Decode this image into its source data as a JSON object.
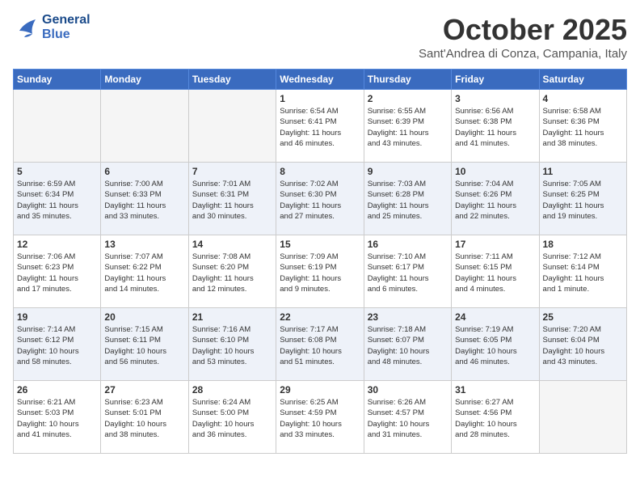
{
  "header": {
    "logo_line1": "General",
    "logo_line2": "Blue",
    "month": "October 2025",
    "location": "Sant'Andrea di Conza, Campania, Italy"
  },
  "days_of_week": [
    "Sunday",
    "Monday",
    "Tuesday",
    "Wednesday",
    "Thursday",
    "Friday",
    "Saturday"
  ],
  "weeks": [
    [
      {
        "day": "",
        "info": ""
      },
      {
        "day": "",
        "info": ""
      },
      {
        "day": "",
        "info": ""
      },
      {
        "day": "1",
        "info": "Sunrise: 6:54 AM\nSunset: 6:41 PM\nDaylight: 11 hours\nand 46 minutes."
      },
      {
        "day": "2",
        "info": "Sunrise: 6:55 AM\nSunset: 6:39 PM\nDaylight: 11 hours\nand 43 minutes."
      },
      {
        "day": "3",
        "info": "Sunrise: 6:56 AM\nSunset: 6:38 PM\nDaylight: 11 hours\nand 41 minutes."
      },
      {
        "day": "4",
        "info": "Sunrise: 6:58 AM\nSunset: 6:36 PM\nDaylight: 11 hours\nand 38 minutes."
      }
    ],
    [
      {
        "day": "5",
        "info": "Sunrise: 6:59 AM\nSunset: 6:34 PM\nDaylight: 11 hours\nand 35 minutes."
      },
      {
        "day": "6",
        "info": "Sunrise: 7:00 AM\nSunset: 6:33 PM\nDaylight: 11 hours\nand 33 minutes."
      },
      {
        "day": "7",
        "info": "Sunrise: 7:01 AM\nSunset: 6:31 PM\nDaylight: 11 hours\nand 30 minutes."
      },
      {
        "day": "8",
        "info": "Sunrise: 7:02 AM\nSunset: 6:30 PM\nDaylight: 11 hours\nand 27 minutes."
      },
      {
        "day": "9",
        "info": "Sunrise: 7:03 AM\nSunset: 6:28 PM\nDaylight: 11 hours\nand 25 minutes."
      },
      {
        "day": "10",
        "info": "Sunrise: 7:04 AM\nSunset: 6:26 PM\nDaylight: 11 hours\nand 22 minutes."
      },
      {
        "day": "11",
        "info": "Sunrise: 7:05 AM\nSunset: 6:25 PM\nDaylight: 11 hours\nand 19 minutes."
      }
    ],
    [
      {
        "day": "12",
        "info": "Sunrise: 7:06 AM\nSunset: 6:23 PM\nDaylight: 11 hours\nand 17 minutes."
      },
      {
        "day": "13",
        "info": "Sunrise: 7:07 AM\nSunset: 6:22 PM\nDaylight: 11 hours\nand 14 minutes."
      },
      {
        "day": "14",
        "info": "Sunrise: 7:08 AM\nSunset: 6:20 PM\nDaylight: 11 hours\nand 12 minutes."
      },
      {
        "day": "15",
        "info": "Sunrise: 7:09 AM\nSunset: 6:19 PM\nDaylight: 11 hours\nand 9 minutes."
      },
      {
        "day": "16",
        "info": "Sunrise: 7:10 AM\nSunset: 6:17 PM\nDaylight: 11 hours\nand 6 minutes."
      },
      {
        "day": "17",
        "info": "Sunrise: 7:11 AM\nSunset: 6:15 PM\nDaylight: 11 hours\nand 4 minutes."
      },
      {
        "day": "18",
        "info": "Sunrise: 7:12 AM\nSunset: 6:14 PM\nDaylight: 11 hours\nand 1 minute."
      }
    ],
    [
      {
        "day": "19",
        "info": "Sunrise: 7:14 AM\nSunset: 6:12 PM\nDaylight: 10 hours\nand 58 minutes."
      },
      {
        "day": "20",
        "info": "Sunrise: 7:15 AM\nSunset: 6:11 PM\nDaylight: 10 hours\nand 56 minutes."
      },
      {
        "day": "21",
        "info": "Sunrise: 7:16 AM\nSunset: 6:10 PM\nDaylight: 10 hours\nand 53 minutes."
      },
      {
        "day": "22",
        "info": "Sunrise: 7:17 AM\nSunset: 6:08 PM\nDaylight: 10 hours\nand 51 minutes."
      },
      {
        "day": "23",
        "info": "Sunrise: 7:18 AM\nSunset: 6:07 PM\nDaylight: 10 hours\nand 48 minutes."
      },
      {
        "day": "24",
        "info": "Sunrise: 7:19 AM\nSunset: 6:05 PM\nDaylight: 10 hours\nand 46 minutes."
      },
      {
        "day": "25",
        "info": "Sunrise: 7:20 AM\nSunset: 6:04 PM\nDaylight: 10 hours\nand 43 minutes."
      }
    ],
    [
      {
        "day": "26",
        "info": "Sunrise: 6:21 AM\nSunset: 5:03 PM\nDaylight: 10 hours\nand 41 minutes."
      },
      {
        "day": "27",
        "info": "Sunrise: 6:23 AM\nSunset: 5:01 PM\nDaylight: 10 hours\nand 38 minutes."
      },
      {
        "day": "28",
        "info": "Sunrise: 6:24 AM\nSunset: 5:00 PM\nDaylight: 10 hours\nand 36 minutes."
      },
      {
        "day": "29",
        "info": "Sunrise: 6:25 AM\nSunset: 4:59 PM\nDaylight: 10 hours\nand 33 minutes."
      },
      {
        "day": "30",
        "info": "Sunrise: 6:26 AM\nSunset: 4:57 PM\nDaylight: 10 hours\nand 31 minutes."
      },
      {
        "day": "31",
        "info": "Sunrise: 6:27 AM\nSunset: 4:56 PM\nDaylight: 10 hours\nand 28 minutes."
      },
      {
        "day": "",
        "info": ""
      }
    ]
  ]
}
